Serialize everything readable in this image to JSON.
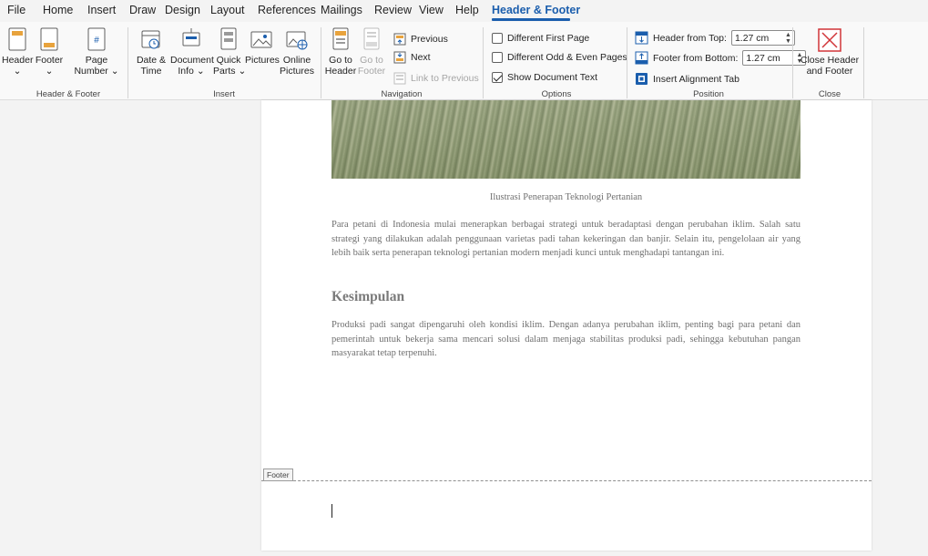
{
  "menu": {
    "tabs": [
      "File",
      "Home",
      "Insert",
      "Draw",
      "Design",
      "Layout",
      "References",
      "Mailings",
      "Review",
      "View",
      "Help",
      "Header & Footer"
    ]
  },
  "ribbon": {
    "header_footer": {
      "header": "Header",
      "footer": "Footer",
      "page": "Page",
      "number": "Number",
      "label": "Header & Footer"
    },
    "insert": {
      "date_l1": "Date &",
      "date_l2": "Time",
      "doc_l1": "Document",
      "doc_l2": "Info",
      "quick_l1": "Quick",
      "quick_l2": "Parts",
      "pictures": "Pictures",
      "online_l1": "Online",
      "online_l2": "Pictures",
      "label": "Insert"
    },
    "navigation": {
      "goto_header_l1": "Go to",
      "goto_header_l2": "Header",
      "goto_footer_l1": "Go to",
      "goto_footer_l2": "Footer",
      "previous": "Previous",
      "next": "Next",
      "link": "Link to Previous",
      "label": "Navigation"
    },
    "options": {
      "first_page": "Different First Page",
      "odd_even": "Different Odd & Even Pages",
      "show_doc": "Show Document Text",
      "first_page_checked": false,
      "odd_even_checked": false,
      "show_doc_checked": true,
      "label": "Options"
    },
    "position": {
      "header_top": "Header from Top:",
      "header_top_value": "1.27 cm",
      "footer_bottom": "Footer from Bottom:",
      "footer_bottom_value": "1.27 cm",
      "align_tab": "Insert Alignment Tab",
      "label": "Position"
    },
    "close": {
      "l1": "Close Header",
      "l2": "and Footer",
      "label": "Close"
    }
  },
  "document": {
    "caption": "Ilustrasi Penerapan Teknologi Pertanian",
    "para1": "Para petani di Indonesia mulai menerapkan berbagai strategi untuk beradaptasi dengan perubahan iklim. Salah satu strategi yang dilakukan adalah penggunaan varietas padi tahan kekeringan dan banjir. Selain itu, pengelolaan air yang lebih baik serta penerapan teknologi pertanian modern menjadi kunci untuk menghadapi tantangan ini.",
    "heading": "Kesimpulan",
    "para2": "Produksi padi sangat dipengaruhi oleh kondisi iklim. Dengan adanya perubahan iklim, penting bagi para petani dan pemerintah untuk bekerja sama mencari solusi dalam menjaga stabilitas produksi padi, sehingga kebutuhan pangan masyarakat tetap terpenuhi.",
    "footer_tag": "Footer"
  },
  "colors": {
    "accent": "#1b5ead",
    "close_red": "#d13438"
  }
}
